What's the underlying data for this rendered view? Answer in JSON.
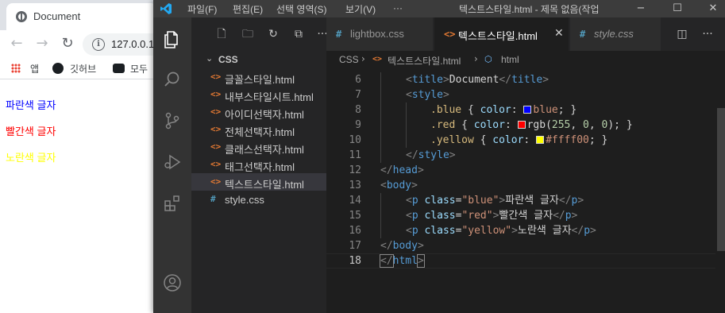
{
  "browser": {
    "tab_title": "Document",
    "url": "127.0.0.1",
    "bookmarks": [
      {
        "icon": "apps-grid-icon",
        "label": "앱"
      },
      {
        "icon": "github-icon",
        "label": "깃허브"
      },
      {
        "icon": "cloud-icon",
        "label": "모두"
      }
    ],
    "page_lines": [
      {
        "text": "파란색 글자",
        "color": "#0000ff"
      },
      {
        "text": "빨간색 글자",
        "color": "#ff0000"
      },
      {
        "text": "노란색 글자",
        "color": "#ffff00"
      }
    ]
  },
  "vscode": {
    "menu": [
      "파일(F)",
      "편집(E)",
      "선택 영역(S)",
      "보기(V)",
      "···"
    ],
    "window_title": "텍스트스타일.html - 제목 없음(작업",
    "explorer": {
      "folder": "CSS",
      "files": [
        {
          "name": "글꼴스타일.html",
          "type": "html"
        },
        {
          "name": "내부스타일시트.html",
          "type": "html"
        },
        {
          "name": "아이디선택자.html",
          "type": "html"
        },
        {
          "name": "전체선택자.html",
          "type": "html"
        },
        {
          "name": "클래스선택자.html",
          "type": "html"
        },
        {
          "name": "태그선택자.html",
          "type": "html"
        },
        {
          "name": "텍스트스타일.html",
          "type": "html",
          "active": true
        },
        {
          "name": "style.css",
          "type": "css"
        }
      ]
    },
    "tabs": [
      {
        "label": "lightbox.css",
        "type": "css"
      },
      {
        "label": "텍스트스타일.html",
        "type": "html",
        "active": true
      },
      {
        "label": "style.css",
        "type": "css"
      }
    ],
    "breadcrumb": [
      "CSS",
      "텍스트스타일.html",
      "html"
    ],
    "line_numbers": [
      "6",
      "7",
      "8",
      "9",
      "10",
      "11",
      "12",
      "13",
      "14",
      "15",
      "16",
      "17",
      "18"
    ],
    "swatch_colors": {
      "blue": "#0000ff",
      "red": "#ff0000",
      "yellow": "#ffff00"
    },
    "code": {
      "l6": [
        "<",
        "title",
        ">",
        "Document",
        "</",
        "title",
        ">"
      ],
      "l7": [
        "<",
        "style",
        ">"
      ],
      "l8": [
        ".blue",
        " { ",
        "color",
        ": ",
        "blue",
        "; }"
      ],
      "l9": [
        ".red",
        " { ",
        "color",
        ": ",
        "rgb(",
        "255",
        ", ",
        "0",
        ", ",
        "0",
        "); }"
      ],
      "l10": [
        ".yellow",
        " { ",
        "color",
        ": ",
        "#ffff00",
        "; }"
      ],
      "l11": [
        "</",
        "style",
        ">"
      ],
      "l12": [
        "</",
        "head",
        ">"
      ],
      "l13": [
        "<",
        "body",
        ">"
      ],
      "l14": [
        "<",
        "p",
        " ",
        "class",
        "=",
        "\"blue\"",
        ">",
        "파란색 글자",
        "</",
        "p",
        ">"
      ],
      "l15": [
        "<",
        "p",
        " ",
        "class",
        "=",
        "\"red\"",
        ">",
        "빨간색 글자",
        "</",
        "p",
        ">"
      ],
      "l16": [
        "<",
        "p",
        " ",
        "class",
        "=",
        "\"yellow\"",
        ">",
        "노란색 글자",
        "</",
        "p",
        ">"
      ],
      "l17": [
        "</",
        "body",
        ">"
      ],
      "l18": [
        "</",
        "html",
        ">"
      ]
    }
  }
}
